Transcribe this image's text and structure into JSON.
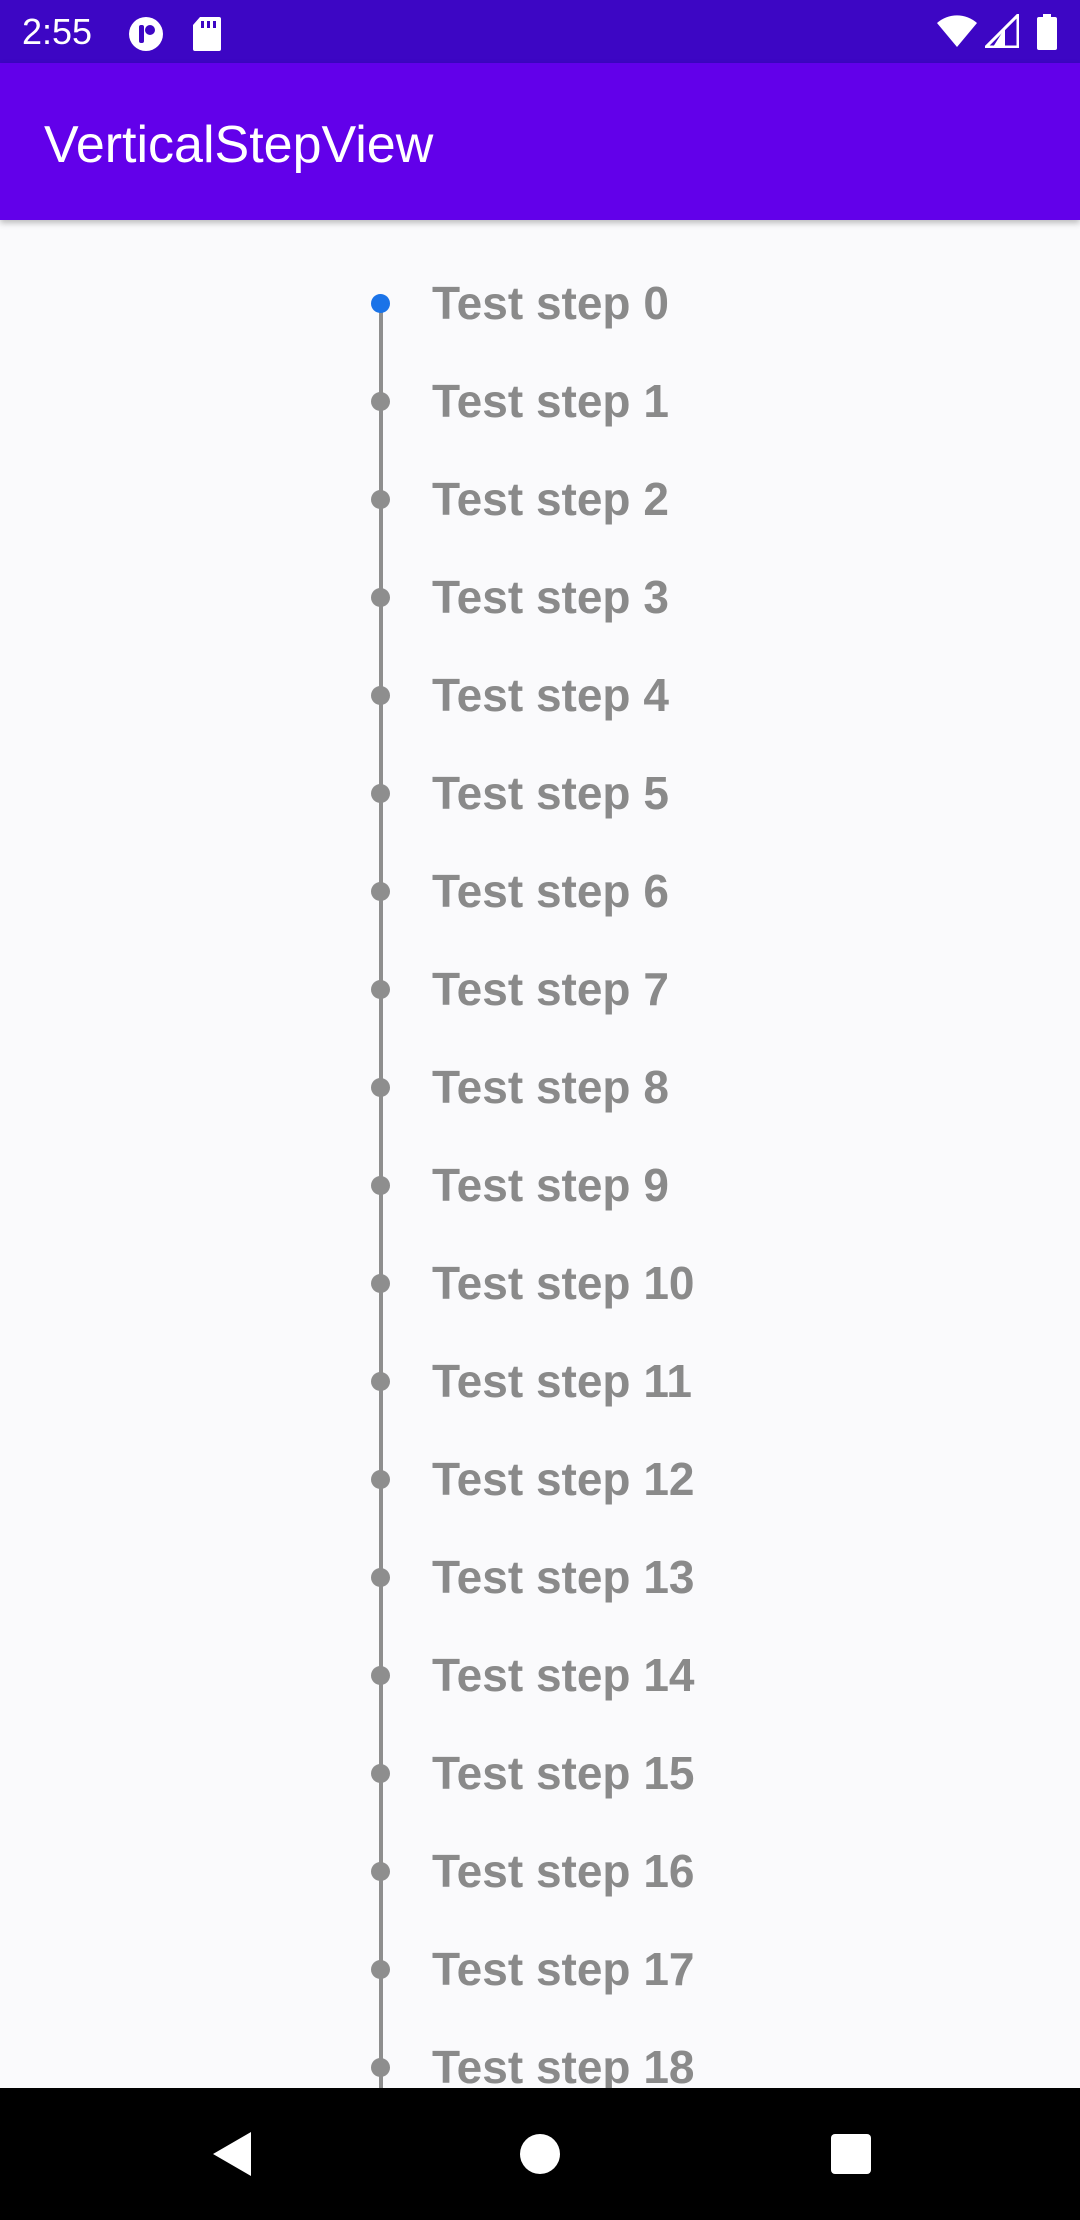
{
  "status_bar": {
    "time": "2:55",
    "left_icons": [
      "app-notification-icon",
      "sd-card-icon"
    ],
    "right_icons": [
      "wifi-icon",
      "signal-icon",
      "battery-icon"
    ]
  },
  "app_bar": {
    "title": "VerticalStepView"
  },
  "step_view": {
    "active_index": 0,
    "active_color": "#1a73e8",
    "inactive_color": "#8e8e8e",
    "steps": [
      {
        "label": "Test step 0"
      },
      {
        "label": "Test step 1"
      },
      {
        "label": "Test step 2"
      },
      {
        "label": "Test step 3"
      },
      {
        "label": "Test step 4"
      },
      {
        "label": "Test step 5"
      },
      {
        "label": "Test step 6"
      },
      {
        "label": "Test step 7"
      },
      {
        "label": "Test step 8"
      },
      {
        "label": "Test step 9"
      },
      {
        "label": "Test step 10"
      },
      {
        "label": "Test step 11"
      },
      {
        "label": "Test step 12"
      },
      {
        "label": "Test step 13"
      },
      {
        "label": "Test step 14"
      },
      {
        "label": "Test step 15"
      },
      {
        "label": "Test step 16"
      },
      {
        "label": "Test step 17"
      },
      {
        "label": "Test step 18"
      }
    ]
  },
  "nav_bar": {
    "buttons": [
      "back-icon",
      "home-icon",
      "recents-icon"
    ]
  }
}
